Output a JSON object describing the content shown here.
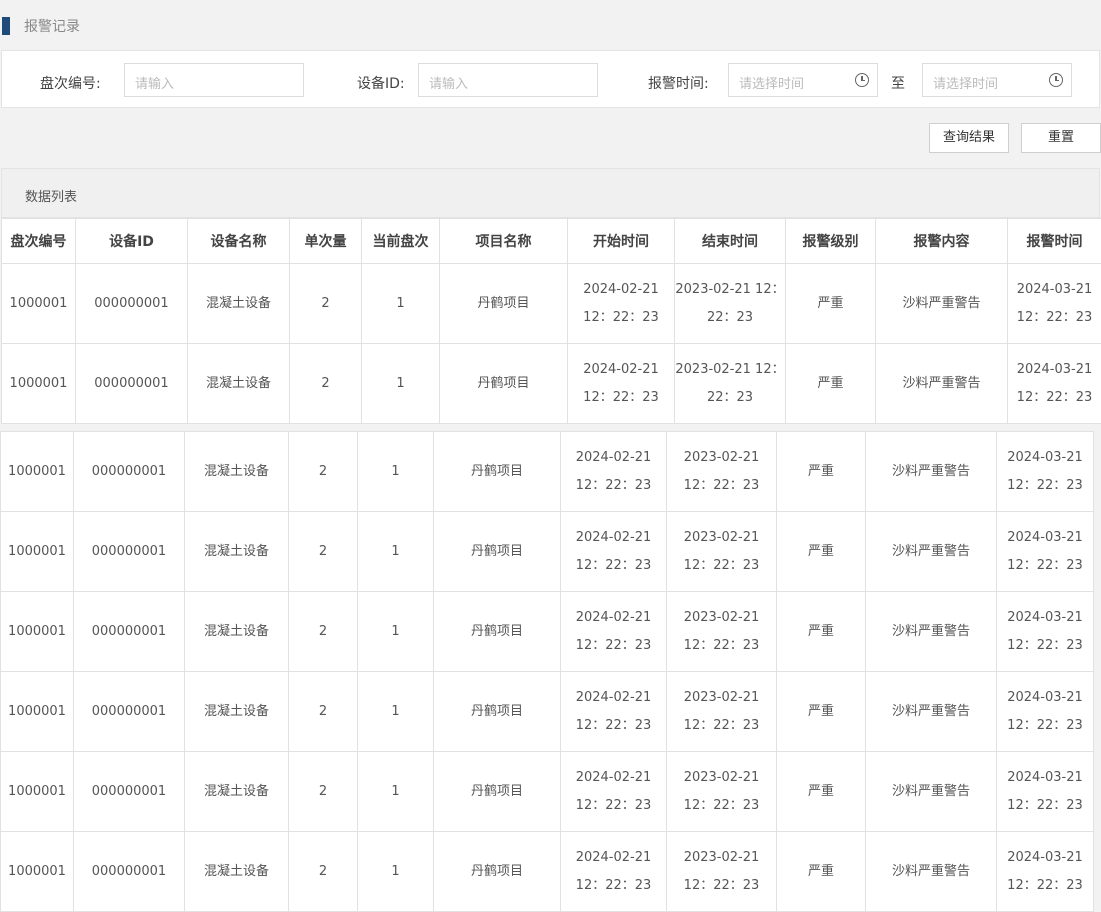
{
  "page": {
    "title": "报警记录"
  },
  "filters": {
    "round_label": "盘次编号:",
    "round_placeholder": "请输入",
    "device_label": "设备ID:",
    "device_placeholder": "请输入",
    "time_label": "报警时间:",
    "time_start_placeholder": "请选择时间",
    "time_sep": "至",
    "time_end_placeholder": "请选择时间"
  },
  "actions": {
    "query": "查询结果",
    "reset": "重置"
  },
  "list": {
    "title": "数据列表",
    "columns": [
      "盘次编号",
      "设备ID",
      "设备名称",
      "单次量",
      "当前盘次",
      "项目名称",
      "开始时间",
      "结束时间",
      "报警级别",
      "报警内容",
      "报警时间"
    ],
    "rows": [
      [
        "1000001",
        "000000001",
        "混凝土设备",
        "2",
        "1",
        "丹鹤项目",
        "2024-02-21 12：22：23",
        "2023-02-21 12：22：23",
        "严重",
        "沙料严重警告",
        "2024-03-21 12：22：23"
      ],
      [
        "1000001",
        "000000001",
        "混凝土设备",
        "2",
        "1",
        "丹鹤项目",
        "2024-02-21 12：22：23",
        "2023-02-21 12：22：23",
        "严重",
        "沙料严重警告",
        "2024-03-21 12：22：23"
      ],
      [
        "1000001",
        "000000001",
        "混凝土设备",
        "2",
        "1",
        "丹鹤项目",
        "2024-02-21 12：22：23",
        "2023-02-21 12：22：23",
        "严重",
        "沙料严重警告",
        "2024-03-21 12：22：23"
      ],
      [
        "1000001",
        "000000001",
        "混凝土设备",
        "2",
        "1",
        "丹鹤项目",
        "2024-02-21 12：22：23",
        "2023-02-21 12：22：23",
        "严重",
        "沙料严重警告",
        "2024-03-21 12：22：23"
      ],
      [
        "1000001",
        "000000001",
        "混凝土设备",
        "2",
        "1",
        "丹鹤项目",
        "2024-02-21 12：22：23",
        "2023-02-21 12：22：23",
        "严重",
        "沙料严重警告",
        "2024-03-21 12：22：23"
      ],
      [
        "1000001",
        "000000001",
        "混凝土设备",
        "2",
        "1",
        "丹鹤项目",
        "2024-02-21 12：22：23",
        "2023-02-21 12：22：23",
        "严重",
        "沙料严重警告",
        "2024-03-21 12：22：23"
      ],
      [
        "1000001",
        "000000001",
        "混凝土设备",
        "2",
        "1",
        "丹鹤项目",
        "2024-02-21 12：22：23",
        "2023-02-21 12：22：23",
        "严重",
        "沙料严重警告",
        "2024-03-21 12：22：23"
      ],
      [
        "1000001",
        "000000001",
        "混凝土设备",
        "2",
        "1",
        "丹鹤项目",
        "2024-02-21 12：22：23",
        "2023-02-21 12：22：23",
        "严重",
        "沙料严重警告",
        "2024-03-21 12：22：23"
      ]
    ]
  }
}
